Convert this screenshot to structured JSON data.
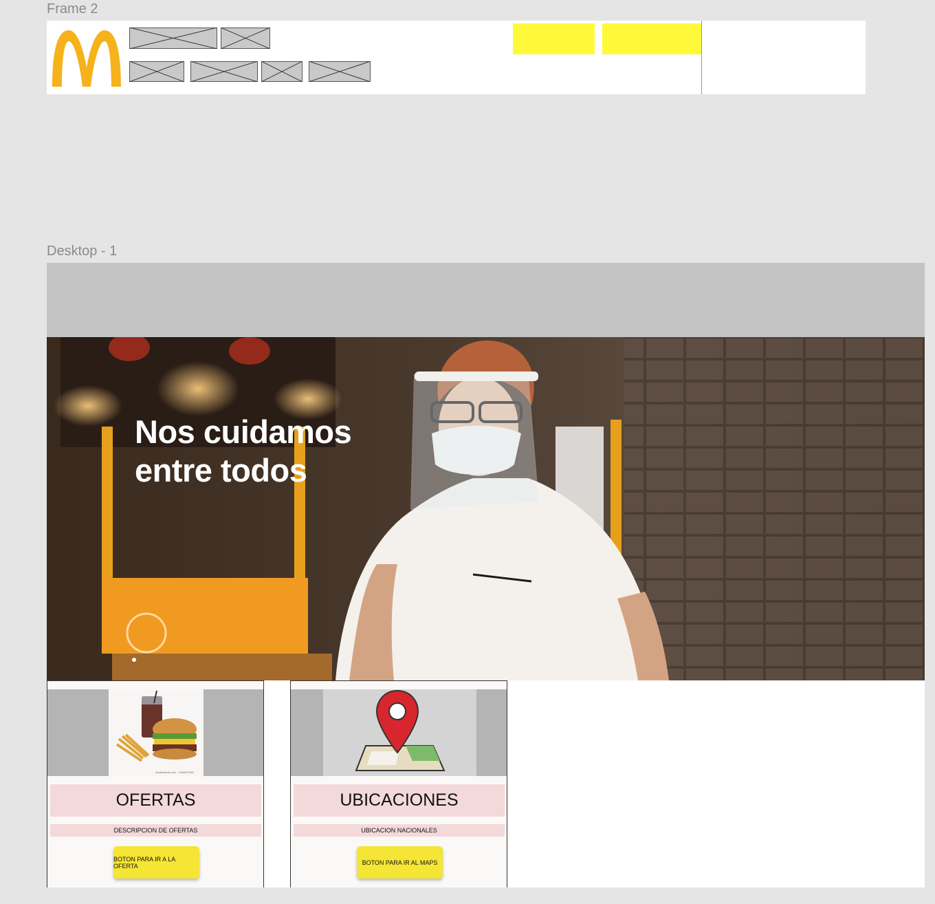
{
  "frame2": {
    "label": "Frame 2",
    "logo_icon": "golden-arches-icon",
    "accent_color": "#fff93a",
    "logo_color": "#f5b21b"
  },
  "desktop": {
    "label": "Desktop - 1",
    "hero": {
      "title": "Nos cuidamos\nentre todos"
    },
    "cards": [
      {
        "title": "OFERTAS",
        "description": "DESCRIPCION DE OFERTAS",
        "button_label": "BOTON PARA IR A LA OFERTA",
        "image_icon": "burger-fries-drink-icon",
        "image_caption": "shutterstock.com · 1348977602"
      },
      {
        "title": "UBICACIONES",
        "description": "UBICACION  NACIONALES",
        "button_label": "BOTON PARA IR AL MAPS",
        "image_icon": "map-pin-icon"
      }
    ],
    "colors": {
      "card_bar": "#f3d9da",
      "card_button": "#f5e534",
      "header_gray": "#c4c4c4"
    }
  }
}
